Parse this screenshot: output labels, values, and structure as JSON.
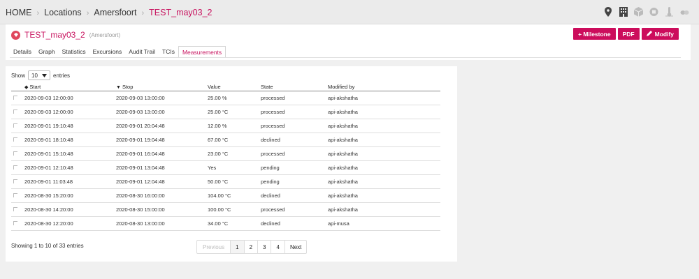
{
  "breadcrumb": {
    "home": "HOME",
    "locations": "Locations",
    "city": "Amersfoort",
    "current": "TEST_may03_2",
    "separator": "›"
  },
  "toolbar_icons": [
    "map-marker-icon",
    "building-icon",
    "cube-icon",
    "box-icon",
    "thermometer-icon",
    "pills-icon"
  ],
  "location": {
    "title": "TEST_may03_2",
    "subtitle": "(Amersfoort)"
  },
  "actions": {
    "milestone": "+ Milestone",
    "pdf": "PDF",
    "modify": "Modify"
  },
  "tabs": [
    "Details",
    "Graph",
    "Statistics",
    "Excursions",
    "Audit Trail",
    "TCIs",
    "Measurements"
  ],
  "active_tab": "Measurements",
  "table_controls": {
    "show_label": "Show",
    "page_length": "10",
    "entries_label": "entries"
  },
  "columns": [
    "Start",
    "Stop",
    "Value",
    "State",
    "Modified by"
  ],
  "rows": [
    {
      "start": "2020-09-03 12:00:00",
      "stop": "2020-09-03 13:00:00",
      "value": "25.00 %",
      "state": "processed",
      "modified_by": "api-akshatha"
    },
    {
      "start": "2020-09-03 12:00:00",
      "stop": "2020-09-03 13:00:00",
      "value": "25.00 °C",
      "state": "processed",
      "modified_by": "api-akshatha"
    },
    {
      "start": "2020-09-01 19:10:48",
      "stop": "2020-09-01 20:04:48",
      "value": "12.00 %",
      "state": "processed",
      "modified_by": "api-akshatha"
    },
    {
      "start": "2020-09-01 18:10:48",
      "stop": "2020-09-01 19:04:48",
      "value": "67.00 °C",
      "state": "declined",
      "modified_by": "api-akshatha"
    },
    {
      "start": "2020-09-01 15:10:48",
      "stop": "2020-09-01 16:04:48",
      "value": "23.00 °C",
      "state": "processed",
      "modified_by": "api-akshatha"
    },
    {
      "start": "2020-09-01 12:10:48",
      "stop": "2020-09-01 13:04:48",
      "value": "Yes",
      "state": "pending",
      "modified_by": "api-akshatha"
    },
    {
      "start": "2020-09-01 11:03:48",
      "stop": "2020-09-01 12:04:48",
      "value": "50.00 °C",
      "state": "pending",
      "modified_by": "api-akshatha"
    },
    {
      "start": "2020-08-30 15:20:00",
      "stop": "2020-08-30 16:00:00",
      "value": "104.00 °C",
      "state": "declined",
      "modified_by": "api-akshatha"
    },
    {
      "start": "2020-08-30 14:20:00",
      "stop": "2020-08-30 15:00:00",
      "value": "100.00 °C",
      "state": "processed",
      "modified_by": "api-akshatha"
    },
    {
      "start": "2020-08-30 12:20:00",
      "stop": "2020-08-30 13:00:00",
      "value": "34.00 °C",
      "state": "declined",
      "modified_by": "api-musa"
    }
  ],
  "footer": {
    "info": "Showing 1 to 10 of 33 entries",
    "previous": "Previous",
    "pages": [
      "1",
      "2",
      "3",
      "4"
    ],
    "current_page": "1",
    "next": "Next"
  },
  "colors": {
    "accent": "#cc0d5c",
    "link": "#c8135f"
  }
}
